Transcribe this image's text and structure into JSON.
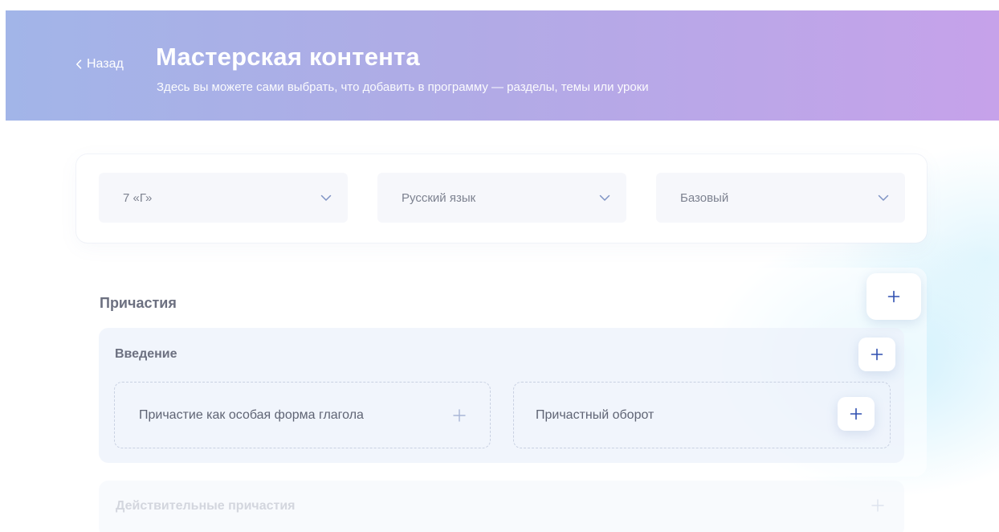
{
  "header": {
    "back_label": "Назад",
    "title": "Мастерская контента",
    "subtitle": "Здесь вы можете сами выбрать, что добавить в программу — разделы, темы или уроки"
  },
  "filters": {
    "class_value": "7 «Г»",
    "subject_value": "Русский язык",
    "level_value": "Базовый"
  },
  "section": {
    "title": "Причастия",
    "add_icon": "plus-icon"
  },
  "topic": {
    "title": "Введение",
    "lessons": [
      {
        "label": "Причастие как особая форма глагола",
        "add_icon": "plus-icon"
      },
      {
        "label": "Причастный оборот",
        "add_icon": "plus-icon"
      }
    ]
  },
  "next_topic": {
    "title": "Действительные причастия"
  },
  "colors": {
    "header_gradient_start": "#a2b5e8",
    "header_gradient_end": "#c6a2ea",
    "accent": "#2f4fb0",
    "text_muted": "#7d8290"
  }
}
